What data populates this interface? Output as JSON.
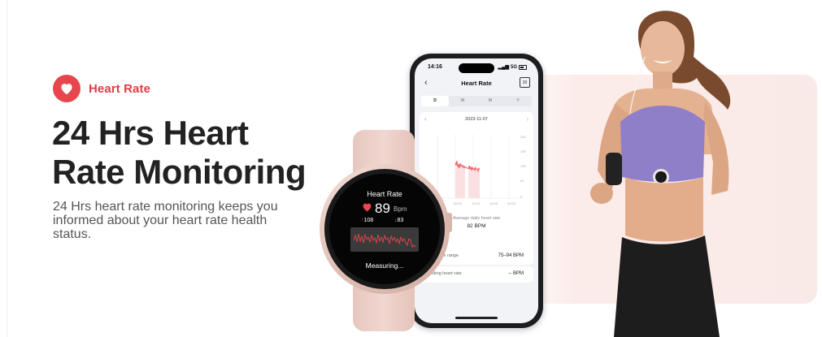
{
  "feature": {
    "badge_label": "Heart Rate",
    "headline_line1": "24 Hrs Heart",
    "headline_line2": "Rate Monitoring",
    "description": "24 Hrs heart rate monitoring keeps you informed about your heart rate health status.",
    "accent_color": "#e8464d"
  },
  "phone": {
    "status_time": "14:16",
    "status_network": "5G",
    "screen_title": "Heart Rate",
    "calendar_day": "30",
    "tabs": [
      {
        "label": "D",
        "active": true
      },
      {
        "label": "W",
        "active": false
      },
      {
        "label": "M",
        "active": false
      },
      {
        "label": "Y",
        "active": false
      }
    ],
    "chart_date": "2023-11-07",
    "chart_y_ticks": [
      "200",
      "150",
      "100",
      "50",
      "0"
    ],
    "chart_x_ticks": [
      "00:00",
      "06:00",
      "12:00",
      "18:00",
      "00:00"
    ],
    "average_label": "Average daily heart rate",
    "average_value": "82 BPM",
    "rows": [
      {
        "label": "Heart rate range",
        "value": "75–94 BPM"
      },
      {
        "label": "Resting heart rate",
        "value": "-- BPM"
      }
    ]
  },
  "watch": {
    "title": "Heart Rate",
    "value": "89",
    "unit": "Bpm",
    "max": "108",
    "min": "83",
    "status": "Measuring..."
  }
}
